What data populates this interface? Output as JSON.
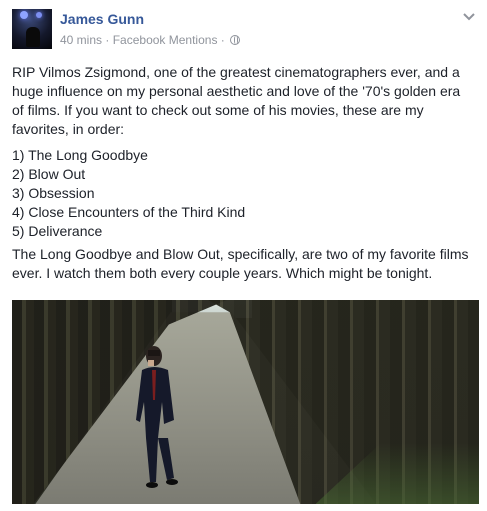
{
  "post": {
    "author": "James Gunn",
    "time": "40 mins",
    "separator": "·",
    "source": "Facebook Mentions",
    "separator2": "·",
    "paragraph1": "RIP Vilmos Zsigmond, one of the greatest cinematographers ever, and a huge influence on my personal aesthetic and love of the '70's golden era of films. If you want to check out some of his movies, these are my favorites, in order:",
    "list": [
      "1) The Long Goodbye",
      "2) Blow Out",
      "3) Obsession",
      "4) Close Encounters of the Third Kind",
      "5) Deliverance"
    ],
    "paragraph2": "The Long Goodbye and Blow Out, specifically, are two of my favorite films ever. I watch them both every couple years. Which might be tonight."
  },
  "icons": {
    "privacy": "globe-icon",
    "menu": "chevron-down-icon"
  },
  "colors": {
    "author_link": "#365899",
    "meta_text": "#90949c",
    "body_text": "#1d2129"
  }
}
